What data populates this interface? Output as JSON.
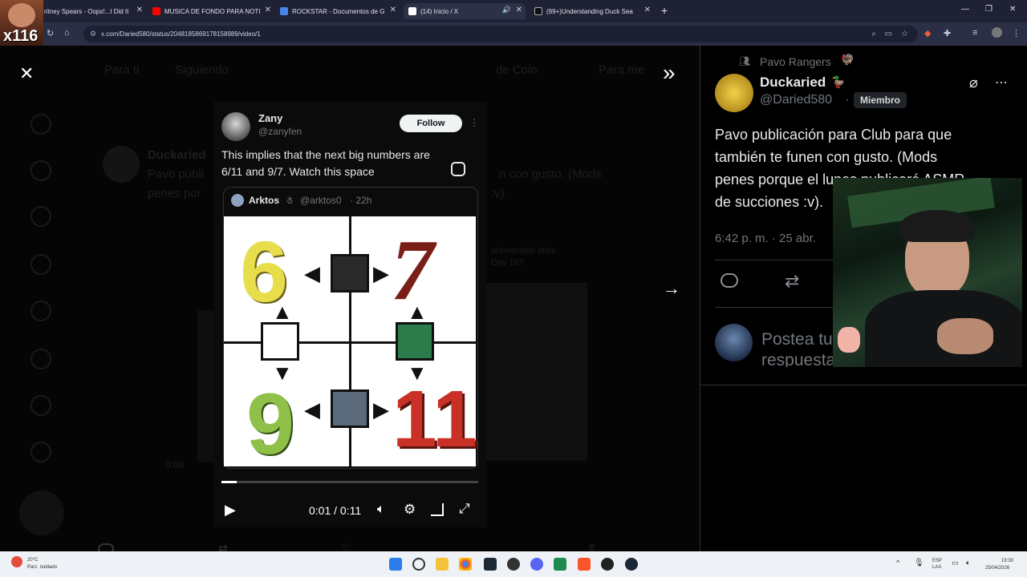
{
  "browser": {
    "tabs": [
      {
        "label": "ritney Spears - Oops!...I Did It",
        "fav": "#e33",
        "close": "✕"
      },
      {
        "label": "MUSICA DE FONDO PARA NOTI",
        "fav": "#f00",
        "close": "✕"
      },
      {
        "label": "ROCKSTAR - Documentos de G",
        "fav": "#4a86ea",
        "close": "✕"
      },
      {
        "label": "(14) Inicio / X",
        "fav": "#fff",
        "close": "✕"
      },
      {
        "label": "(99+)Understanding Duck Sea",
        "fav": "#111",
        "close": "✕"
      }
    ],
    "new_tab": "+",
    "url": "x.com/Daried580/status/2048185869178158989/video/1",
    "window_controls": [
      "—",
      "❐",
      "✕"
    ]
  },
  "streamer_overlay": {
    "tag": "x116"
  },
  "viewer": {
    "close": "✕",
    "expand": "»",
    "next": "→"
  },
  "embedded_tweet": {
    "name": "Zany",
    "handle": "@zanyfen",
    "follow_label": "Follow",
    "more": "⋮",
    "text_line1": "This implies that the next big numbers are",
    "text_line2": "6/11 and 9/7. Watch this space",
    "quoted": {
      "name": "Arktos",
      "handle": "@arktos0",
      "time": "· 22h"
    },
    "meme_numbers": [
      "6",
      "7",
      "9",
      "11"
    ]
  },
  "player": {
    "time": "0:01 / 0:11",
    "progress": 0.06
  },
  "right_panel": {
    "community": "Pavo Rangers",
    "name": "Duckaried",
    "handle": "@Daried580",
    "dot": "·",
    "badge": "Miembro",
    "post_line1": "Pavo publicación para Club para que",
    "post_line2": "también te funen con gusto. (Mods",
    "post_line3": "penes porque el lunes publicaré ASMR",
    "post_line4": "de succiones :v).",
    "timestamp": "6:42 p. m. · 25 abr.",
    "reply_placeholder_1": "Postea tu",
    "reply_placeholder_2": "respuesta"
  },
  "background_ghost": {
    "name": "Duckaried",
    "text1": "Pavo publi",
    "text2": "penes por",
    "snip1": "n con gusto. (Mods",
    "snip2": ":v).",
    "tab1": "Para ti",
    "tab2": "Siguiendo",
    "snip3": "de Coin",
    "snip4": "Para me",
    "video_time": "0:09",
    "story": "unbearable shits",
    "story2": "Day 187"
  },
  "taskbar": {
    "weather_temp": "20°C",
    "weather_desc": "Parc. nublado",
    "lang1": "ESP",
    "lang2": "LAA",
    "clock_time": "19:30",
    "clock_date": "25/04/2026"
  }
}
